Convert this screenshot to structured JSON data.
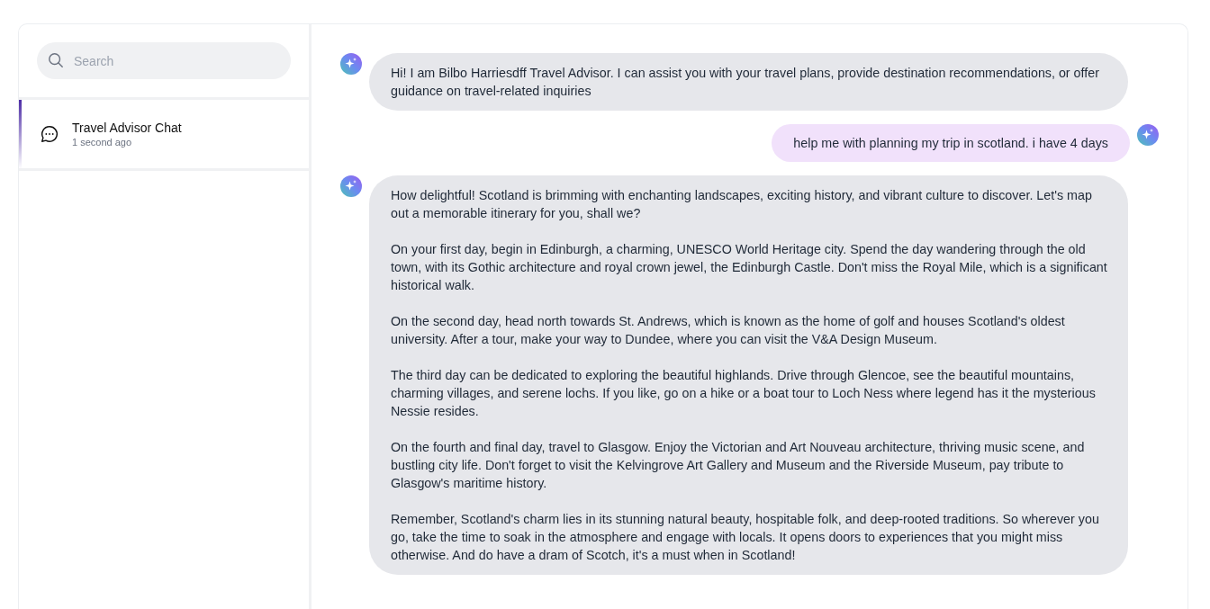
{
  "search": {
    "placeholder": "Search"
  },
  "chats": [
    {
      "title": "Travel Advisor Chat",
      "time": "1 second ago",
      "selected": true
    }
  ],
  "messages": [
    {
      "kind": "assistant",
      "paragraphs": [
        "Hi! I am Bilbo Harriesdff Travel Advisor. I can assist you with your travel plans, provide destination recommendations, or offer guidance on travel-related inquiries"
      ]
    },
    {
      "kind": "user",
      "paragraphs": [
        "help me with planning my trip in scotland. i have 4 days"
      ]
    },
    {
      "kind": "assistant",
      "paragraphs": [
        "How delightful! Scotland is brimming with enchanting landscapes, exciting history, and vibrant culture to discover. Let's map out a memorable itinerary for you, shall we?",
        "On your first day, begin in Edinburgh, a charming, UNESCO World Heritage city. Spend the day wandering through the old town, with its Gothic architecture and royal crown jewel, the Edinburgh Castle. Don't miss the Royal Mile, which is a significant historical walk.",
        "On the second day, head north towards St. Andrews, which is known as the home of golf and houses Scotland's oldest university. After a tour, make your way to Dundee, where you can visit the V&A Design Museum.",
        "The third day can be dedicated to exploring the beautiful highlands. Drive through Glencoe, see the beautiful mountains, charming villages, and serene lochs. If you like, go on a hike or a boat tour to Loch Ness where legend has it the mysterious Nessie resides.",
        "On the fourth and final day, travel to Glasgow. Enjoy the Victorian and Art Nouveau architecture, thriving music scene, and bustling city life. Don't forget to visit the Kelvingrove Art Gallery and Museum and the Riverside Museum, pay tribute to Glasgow's maritime history.",
        "Remember, Scotland's charm lies in its stunning natural beauty, hospitable folk, and deep-rooted traditions. So wherever you go, take the time to soak in the atmosphere and engage with locals. It opens doors to experiences that you might miss otherwise. And do have a dram of Scotch, it's a must when in Scotland!"
      ]
    }
  ]
}
